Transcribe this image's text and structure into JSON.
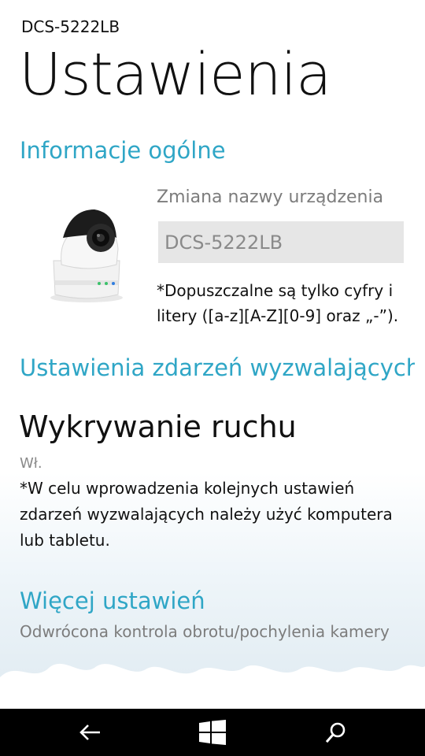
{
  "header": {
    "device_name": "DCS-5222LB",
    "page_title": "Ustawienia"
  },
  "general": {
    "section_title": "Informacje ogólne",
    "rename_label": "Zmiana nazwy urządzenia",
    "rename_value": "DCS-5222LB",
    "rename_hint": "*Dopuszczalne są tylko cyfry i litery ([a-z][A-Z][0-9] oraz „-”)."
  },
  "events": {
    "section_title": "Ustawienia zdarzeń wyzwalających",
    "motion_title": "Wykrywanie ruchu",
    "motion_status": "Wł.",
    "motion_note": "*W celu wprowadzenia kolejnych ustawień zdarzeń wyzwalających należy użyć komputera lub tabletu."
  },
  "more": {
    "section_title": "Więcej ustawień",
    "item_label": "Odwrócona kontrola obrotu/pochylenia kamery"
  },
  "navbar": {
    "back_icon": "back-arrow-icon",
    "start_icon": "windows-logo-icon",
    "search_icon": "search-icon"
  },
  "colors": {
    "accent": "#2fa6c6",
    "navbar": "#000000"
  }
}
